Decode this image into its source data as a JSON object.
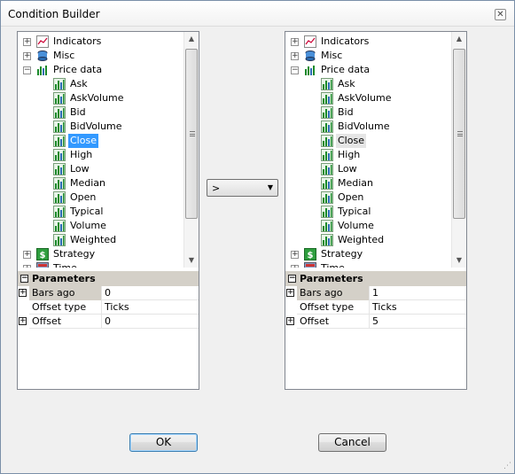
{
  "window": {
    "title": "Condition Builder",
    "close_glyph": "✕"
  },
  "left_panel": {
    "tree": [
      {
        "label": "Indicators",
        "level": 0,
        "expander": "+",
        "icon": "indicators-icon"
      },
      {
        "label": "Misc",
        "level": 0,
        "expander": "+",
        "icon": "misc-icon"
      },
      {
        "label": "Price data",
        "level": 0,
        "expander": "−",
        "icon": "price-data-icon"
      },
      {
        "label": "Ask",
        "level": 1,
        "icon": "series-icon"
      },
      {
        "label": "AskVolume",
        "level": 1,
        "icon": "series-icon"
      },
      {
        "label": "Bid",
        "level": 1,
        "icon": "series-icon"
      },
      {
        "label": "BidVolume",
        "level": 1,
        "icon": "series-icon"
      },
      {
        "label": "Close",
        "level": 1,
        "icon": "series-icon",
        "selected": true
      },
      {
        "label": "High",
        "level": 1,
        "icon": "series-icon"
      },
      {
        "label": "Low",
        "level": 1,
        "icon": "series-icon"
      },
      {
        "label": "Median",
        "level": 1,
        "icon": "series-icon"
      },
      {
        "label": "Open",
        "level": 1,
        "icon": "series-icon"
      },
      {
        "label": "Typical",
        "level": 1,
        "icon": "series-icon"
      },
      {
        "label": "Volume",
        "level": 1,
        "icon": "series-icon"
      },
      {
        "label": "Weighted",
        "level": 1,
        "icon": "series-icon"
      },
      {
        "label": "Strategy",
        "level": 0,
        "expander": "+",
        "icon": "strategy-icon"
      },
      {
        "label": "Time",
        "level": 0,
        "expander": "+",
        "icon": "time-icon"
      }
    ],
    "params": {
      "header": "Parameters",
      "rows": [
        {
          "name": "Bars ago",
          "value": "0",
          "expander": "+"
        },
        {
          "name": "Offset type",
          "value": "Ticks"
        },
        {
          "name": "Offset",
          "value": "0",
          "expander": "+"
        }
      ]
    }
  },
  "right_panel": {
    "tree": [
      {
        "label": "Indicators",
        "level": 0,
        "expander": "+",
        "icon": "indicators-icon"
      },
      {
        "label": "Misc",
        "level": 0,
        "expander": "+",
        "icon": "misc-icon"
      },
      {
        "label": "Price data",
        "level": 0,
        "expander": "−",
        "icon": "price-data-icon"
      },
      {
        "label": "Ask",
        "level": 1,
        "icon": "series-icon"
      },
      {
        "label": "AskVolume",
        "level": 1,
        "icon": "series-icon"
      },
      {
        "label": "Bid",
        "level": 1,
        "icon": "series-icon"
      },
      {
        "label": "BidVolume",
        "level": 1,
        "icon": "series-icon"
      },
      {
        "label": "Close",
        "level": 1,
        "icon": "series-icon",
        "hovered": true
      },
      {
        "label": "High",
        "level": 1,
        "icon": "series-icon"
      },
      {
        "label": "Low",
        "level": 1,
        "icon": "series-icon"
      },
      {
        "label": "Median",
        "level": 1,
        "icon": "series-icon"
      },
      {
        "label": "Open",
        "level": 1,
        "icon": "series-icon"
      },
      {
        "label": "Typical",
        "level": 1,
        "icon": "series-icon"
      },
      {
        "label": "Volume",
        "level": 1,
        "icon": "series-icon"
      },
      {
        "label": "Weighted",
        "level": 1,
        "icon": "series-icon"
      },
      {
        "label": "Strategy",
        "level": 0,
        "expander": "+",
        "icon": "strategy-icon"
      },
      {
        "label": "Time",
        "level": 0,
        "expander": "+",
        "icon": "time-icon"
      }
    ],
    "params": {
      "header": "Parameters",
      "rows": [
        {
          "name": "Bars ago",
          "value": "1",
          "expander": "+"
        },
        {
          "name": "Offset type",
          "value": "Ticks"
        },
        {
          "name": "Offset",
          "value": "5",
          "expander": "+"
        }
      ]
    }
  },
  "operator": {
    "value": ">"
  },
  "buttons": {
    "ok": "OK",
    "cancel": "Cancel"
  },
  "colors": {
    "selection": "#3399ff",
    "grid_header": "#d4d0c8"
  }
}
